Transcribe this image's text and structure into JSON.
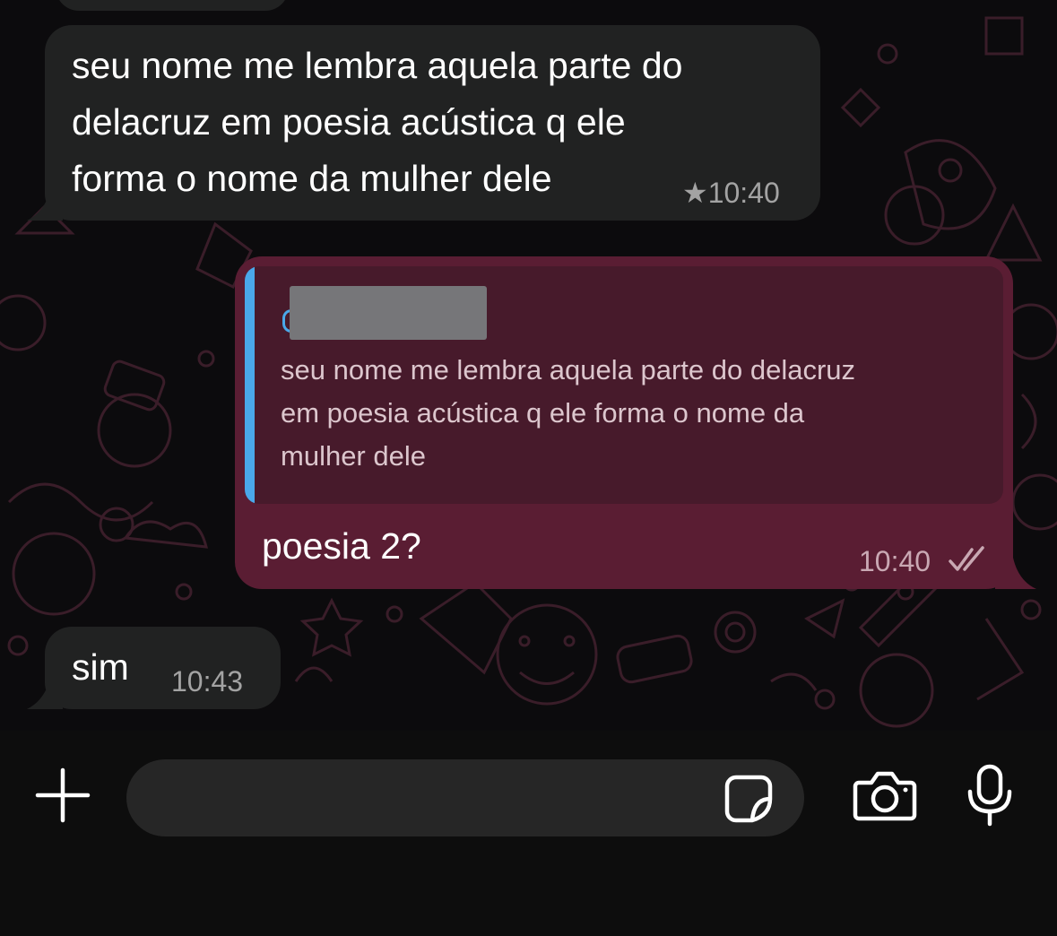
{
  "messages": [
    {
      "type": "incoming",
      "text": "seu nome me lembra aquela parte do\ndelacruz em poesia acústica q ele\nforma o nome da mulher dele",
      "time": "★10:40",
      "starred": true
    },
    {
      "type": "outgoing",
      "reply_to": "seu nome me lembra aquela parte do delacruz\nem poesia acústica q ele forma o nome da\nmulher dele",
      "text": "poesia 2?",
      "time": "10:40",
      "status": "read-double-check"
    },
    {
      "type": "incoming",
      "text": "sim",
      "time": "10:43"
    }
  ],
  "composer": {
    "placeholder": "",
    "icons": [
      "plus-icon",
      "sticker-icon",
      "camera-icon",
      "microphone-icon"
    ]
  },
  "colors": {
    "incoming_bubble": "#212222",
    "outgoing_bubble": "#5a1d33",
    "quote_bar": "#4aa8ea",
    "background": "#0c0b0d"
  }
}
